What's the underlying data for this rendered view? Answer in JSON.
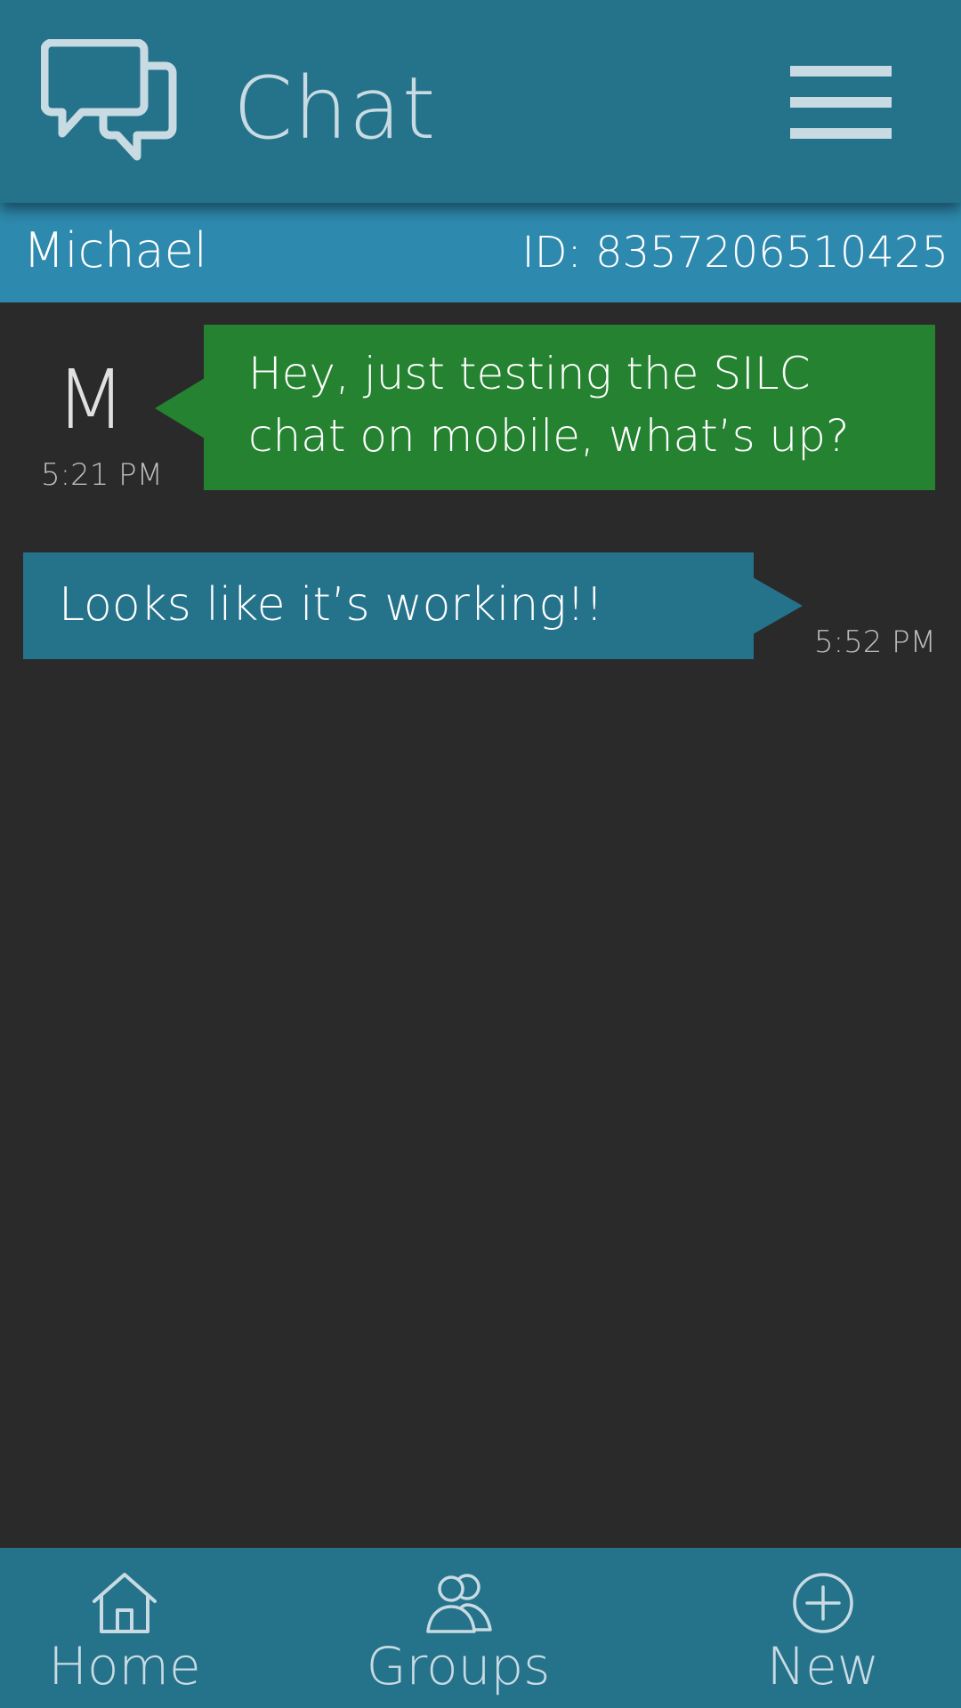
{
  "header": {
    "title": "Chat",
    "logo_icon": "chat-bubbles-icon",
    "menu_icon": "hamburger-menu-icon"
  },
  "contact": {
    "name": "Michael",
    "id_label": "ID: 8357206510425"
  },
  "messages": [
    {
      "direction": "incoming",
      "sender_initial": "M",
      "text": "Hey, just testing the SILC chat on mobile, what’s up?",
      "time": "5:21 PM"
    },
    {
      "direction": "outgoing",
      "text": "Looks like it’s working!!",
      "time": "5:52 PM"
    }
  ],
  "nav": {
    "home": {
      "label": "Home",
      "icon": "home-icon"
    },
    "groups": {
      "label": "Groups",
      "icon": "groups-icon"
    },
    "new": {
      "label": "New",
      "icon": "plus-circle-icon"
    }
  },
  "colors": {
    "header_bg": "#25728b",
    "contact_bar_bg": "#2e89ae",
    "background": "#2a2a2a",
    "incoming_bubble": "#248230",
    "outgoing_bubble": "#25728b",
    "icon_color": "#c8dbe2"
  }
}
